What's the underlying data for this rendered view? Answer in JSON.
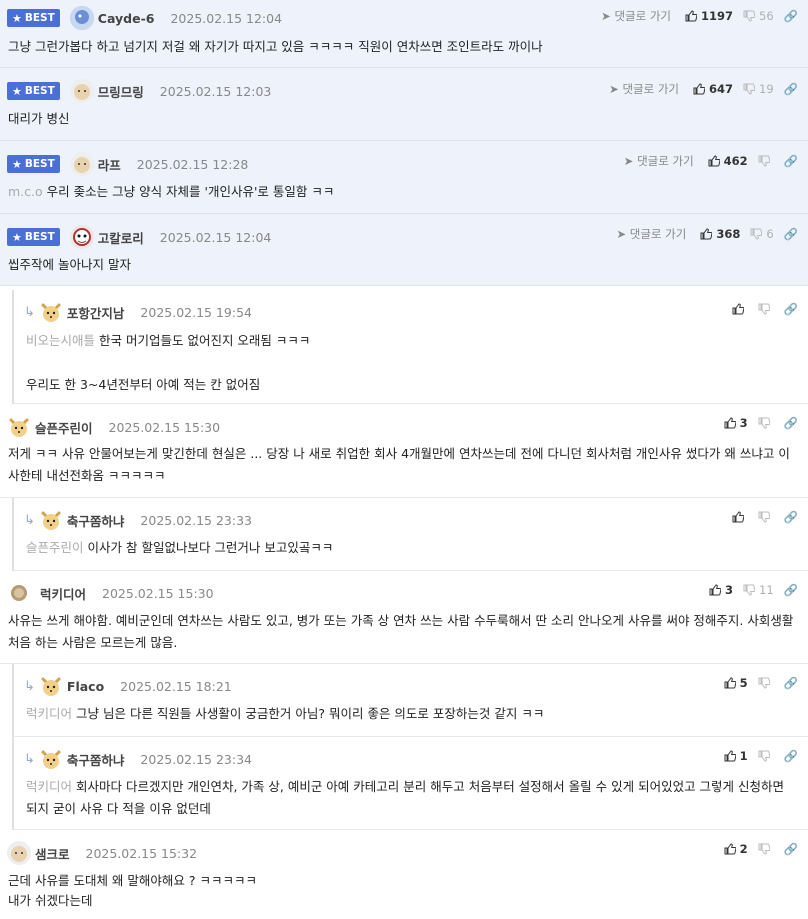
{
  "labels": {
    "best": "BEST",
    "goto": "댓글로 가기"
  },
  "colors": {
    "best_badge": "#4a6fd6",
    "best_bg": "#eef2fb"
  },
  "comments": [
    {
      "nick": "Cayde-6",
      "date": "2025.02.15 12:04",
      "up": "1197",
      "down": "56",
      "text": "그냥 그런가봅다 하고 넘기지 저걸 왜 자기가 따지고 있음 ㅋㅋㅋㅋ 직원이 연차쓰면 조인트라도 까이나",
      "mention": ""
    },
    {
      "nick": "므링므링",
      "date": "2025.02.15 12:03",
      "up": "647",
      "down": "19",
      "text": "대리가 병신",
      "mention": ""
    },
    {
      "nick": "라프",
      "date": "2025.02.15 12:28",
      "up": "462",
      "down": "",
      "text": "우리 좆소는 그냥 양식 자체를 '개인사유'로 통일함 ㅋㅋ",
      "mention": "m.c.o"
    },
    {
      "nick": "고칼로리",
      "date": "2025.02.15 12:04",
      "up": "368",
      "down": "6",
      "text": "씹주작에 놀아나지 말자",
      "mention": ""
    },
    {
      "nick": "포항간지남",
      "date": "2025.02.15 19:54",
      "up": "",
      "down": "",
      "text": "한국 머기업들도 없어진지 오래됨 ㅋㅋㅋ",
      "text2": "우리도 한 3~4년전부터 아예 적는 칸 없어짐",
      "mention": "비오는시애틀"
    },
    {
      "nick": "슬픈주린이",
      "date": "2025.02.15 15:30",
      "up": "3",
      "down": "",
      "text": "저게 ㅋㅋ 사유 안물어보는게 맞긴한데 현실은 ... 당장 나 새로 취업한 회사 4개월만에 연차쓰는데 전에 다니던 회사처럼 개인사유 썼다가 왜 쓰냐고 이사한테 내선전화옴 ㅋㅋㅋㅋㅋ",
      "mention": ""
    },
    {
      "nick": "축구쫌하냐",
      "date": "2025.02.15 23:33",
      "up": "",
      "down": "",
      "text": "이사가 참 할일없나보다 그런거나 보고있곸ㅋㅋ",
      "mention": "슬픈주린이"
    },
    {
      "nick": "럭키디어",
      "date": "2025.02.15 15:30",
      "up": "3",
      "down": "11",
      "text": "사유는 쓰게 해야함. 예비군인데 연차쓰는 사람도 있고, 병가 또는 가족 상 연차 쓰는 사람 수두룩해서 딴 소리 안나오게 사유를 써야 정해주지. 사회생활 처음 하는 사람은 모르는게 많음.",
      "mention": ""
    },
    {
      "nick": "Flaco",
      "date": "2025.02.15 18:21",
      "up": "5",
      "down": "",
      "text": "그냥 님은 다른 직원들 사생활이 궁금한거 아님? 뭐이리 좋은 의도로 포장하는것 같지 ㅋㅋ",
      "mention": "럭키디어"
    },
    {
      "nick": "축구쫌하냐",
      "date": "2025.02.15 23:34",
      "up": "1",
      "down": "",
      "text": "회사마다 다르겠지만 개인연차, 가족 상, 예비군 아예 카테고리 분리 해두고 처음부터 설정해서 올릴 수 있게 되어있었고 그렇게 신청하면 되지 굳이 사유 다 적을 이유 없던데",
      "mention": "럭키디어"
    },
    {
      "nick": "샘크로",
      "date": "2025.02.15 15:32",
      "up": "2",
      "down": "",
      "text": "근데 사유를 도대체 왜 말해야해요 ? ㅋㅋㅋㅋㅋ",
      "text2": "내가 쉬겠다는데",
      "mention": ""
    }
  ]
}
